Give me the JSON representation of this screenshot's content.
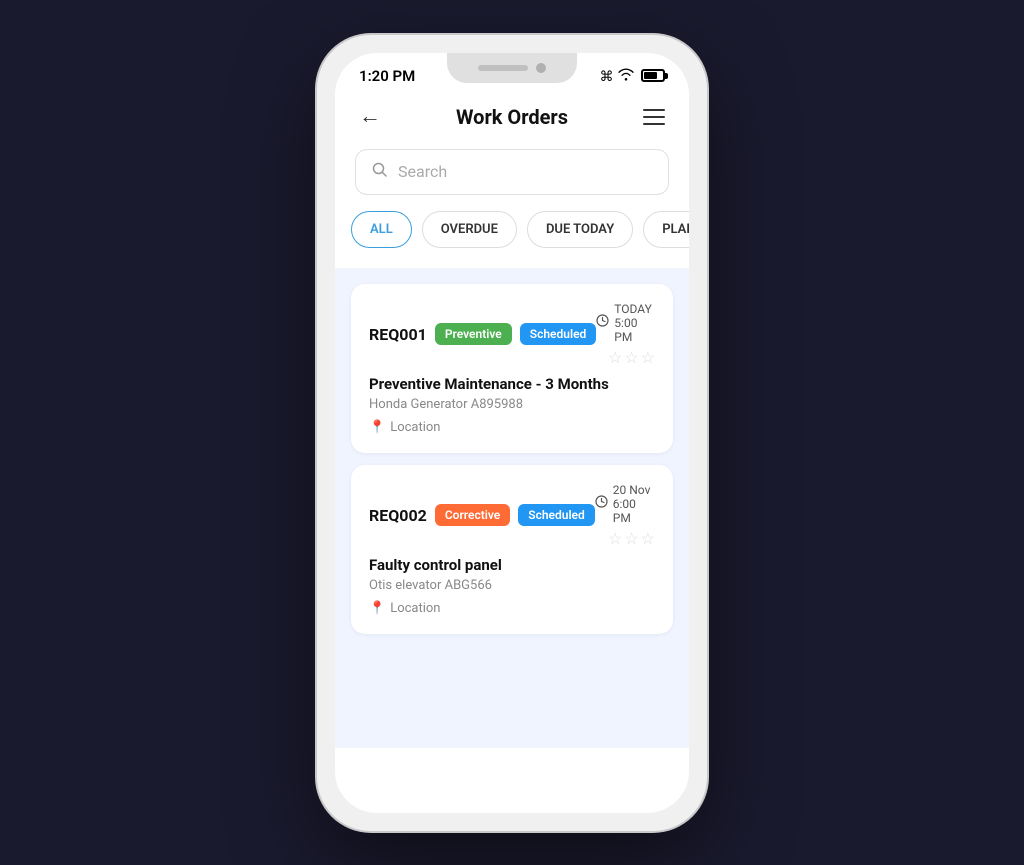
{
  "status_bar": {
    "time": "1:20 PM",
    "wifi": "wifi",
    "battery": "battery"
  },
  "header": {
    "back_label": "←",
    "title": "Work Orders",
    "menu_label": "≡"
  },
  "search": {
    "placeholder": "Search"
  },
  "filter_tabs": [
    {
      "id": "all",
      "label": "ALL",
      "active": true
    },
    {
      "id": "overdue",
      "label": "OVERDUE",
      "active": false
    },
    {
      "id": "due_today",
      "label": "DUE TODAY",
      "active": false
    },
    {
      "id": "planned",
      "label": "PLANNED",
      "active": false
    }
  ],
  "work_orders": [
    {
      "id": "REQ001",
      "type_badge": "Preventive",
      "type_color": "preventive",
      "status_badge": "Scheduled",
      "status_color": "scheduled",
      "due": "TODAY 5:00 PM",
      "stars_filled": 0,
      "stars_total": 3,
      "title": "Preventive Maintenance - 3 Months",
      "subtitle": "Honda Generator A895988",
      "location": "Location"
    },
    {
      "id": "REQ002",
      "type_badge": "Corrective",
      "type_color": "corrective",
      "status_badge": "Scheduled",
      "status_color": "scheduled",
      "due": "20 Nov 6:00 PM",
      "stars_filled": 0,
      "stars_total": 3,
      "title": "Faulty control panel",
      "subtitle": "Otis elevator ABG566",
      "location": "Location"
    }
  ]
}
